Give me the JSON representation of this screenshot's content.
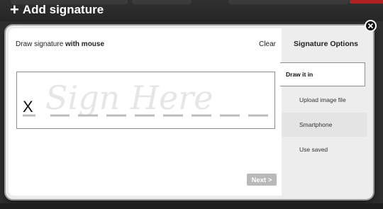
{
  "header": {
    "add_icon": "plus-icon",
    "add_symbol": "+",
    "title": "Add signature"
  },
  "panel": {
    "instruction_prefix": "Draw signature ",
    "instruction_bold": "with mouse",
    "clear_label": "Clear",
    "signature_placeholder": "Sign Here",
    "signature_mark": "X",
    "next_label": "Next >"
  },
  "sidebar": {
    "title": "Signature Options",
    "items": [
      {
        "label": "Draw it in"
      },
      {
        "label": "Upload image file"
      },
      {
        "label": "Smartphone"
      },
      {
        "label": "Use saved"
      }
    ]
  },
  "close_icon": "close-icon"
}
